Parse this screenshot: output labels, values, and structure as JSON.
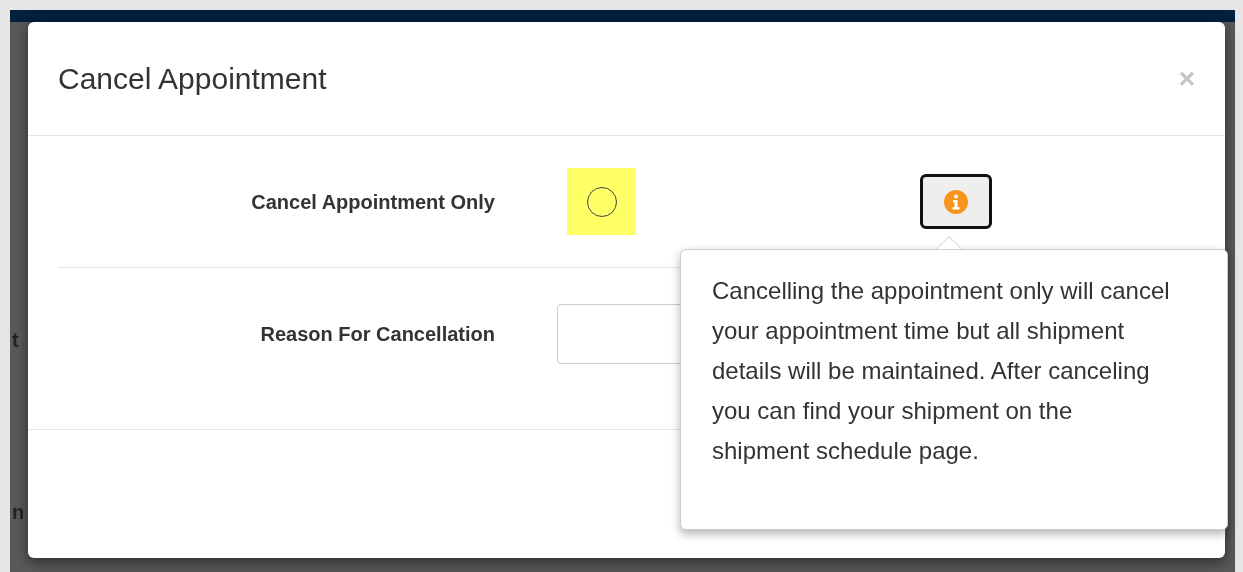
{
  "background": {
    "fragments": [
      "t",
      "n"
    ]
  },
  "modal": {
    "title": "Cancel Appointment",
    "close": "×",
    "rows": [
      {
        "kind": "radio",
        "label": "Cancel Appointment Only",
        "checked": false,
        "highlighted": true
      },
      {
        "kind": "text",
        "label": "Reason For Cancellation"
      }
    ],
    "popover": {
      "text": "Cancelling the appointment only will cancel your appointment time but all shipment details will be maintained. After canceling you can find your shipment on the shipment schedule page."
    }
  }
}
